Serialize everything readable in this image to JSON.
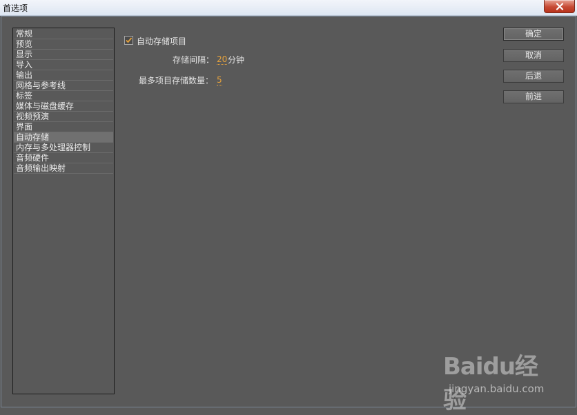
{
  "window": {
    "title": "首选项",
    "close_icon": "close-icon"
  },
  "sidebar": {
    "items": [
      {
        "label": "常规"
      },
      {
        "label": "预览"
      },
      {
        "label": "显示"
      },
      {
        "label": "导入"
      },
      {
        "label": "输出"
      },
      {
        "label": "网格与参考线"
      },
      {
        "label": "标签"
      },
      {
        "label": "媒体与磁盘缓存"
      },
      {
        "label": "视频预演"
      },
      {
        "label": "界面"
      },
      {
        "label": "自动存储",
        "selected": true
      },
      {
        "label": "内存与多处理器控制"
      },
      {
        "label": "音频硬件"
      },
      {
        "label": "音频输出映射"
      }
    ]
  },
  "autosave": {
    "enable_label": "自动存储项目",
    "enabled": true,
    "interval_label": "存储间隔：",
    "interval_value": "20",
    "interval_unit": "分钟",
    "max_label": "最多项目存储数量：",
    "max_value": "5"
  },
  "buttons": {
    "ok": "确定",
    "cancel": "取消",
    "back": "后退",
    "forward": "前进"
  },
  "watermark": {
    "logo": "Baidu经验",
    "url": "jingyan.baidu.com"
  },
  "colors": {
    "accent": "#e8a33c",
    "background": "#595959"
  }
}
